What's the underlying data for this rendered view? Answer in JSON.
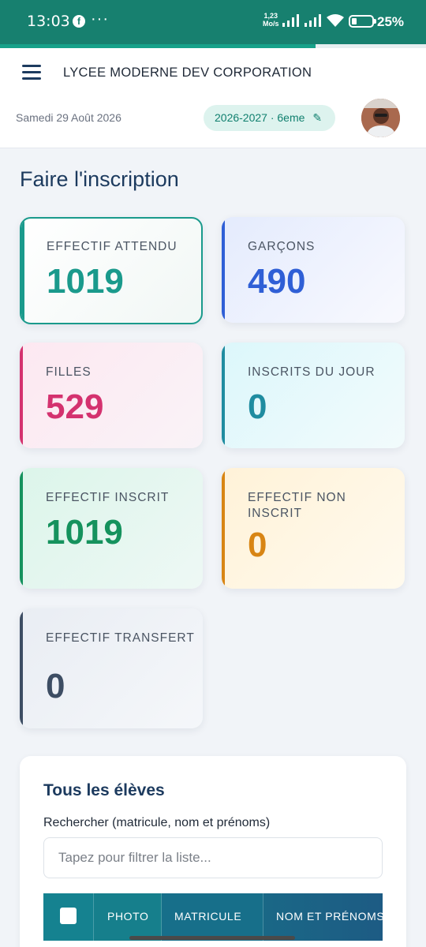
{
  "status_bar": {
    "time": "13:03",
    "facebook_icon": "f",
    "dots": "···",
    "speed_value": "1,23",
    "speed_unit": "Mo/s",
    "battery_percent": "25%",
    "battery_level": 0.25
  },
  "header": {
    "progress": 0.74,
    "school_name": "LYCEE MODERNE DEV CORPORATION",
    "date": "Samedi 29 Août 2026",
    "year_chip": "2026-2027 · 6eme",
    "edit_glyph": "✎"
  },
  "page": {
    "title": "Faire l'inscription"
  },
  "cards": [
    {
      "label": "EFFECTIF ATTENDU",
      "value": "1019",
      "accent": "#1a9a8c"
    },
    {
      "label": "GARÇONS",
      "value": "490",
      "accent": "#2f5fd6"
    },
    {
      "label": "FILLES",
      "value": "529",
      "accent": "#d4326f"
    },
    {
      "label": "INSCRITS DU JOUR",
      "value": "0",
      "accent": "#1f8ca0"
    },
    {
      "label": "EFFECTIF INSCRIT",
      "value": "1019",
      "accent": "#15925d"
    },
    {
      "label": "EFFECTIF NON INSCRIT",
      "value": "0",
      "accent": "#d88514"
    },
    {
      "label": "EFFECTIF TRANSFERT",
      "value": "0",
      "accent": "#3d4d63"
    }
  ],
  "students": {
    "title": "Tous les élèves",
    "search_label": "Rechercher (matricule, nom et prénoms)",
    "search_placeholder": "Tapez pour filtrer la liste...",
    "search_value": "",
    "columns": [
      "PHOTO",
      "MATRICULE",
      "NOM ET PRÉNOMS"
    ]
  }
}
